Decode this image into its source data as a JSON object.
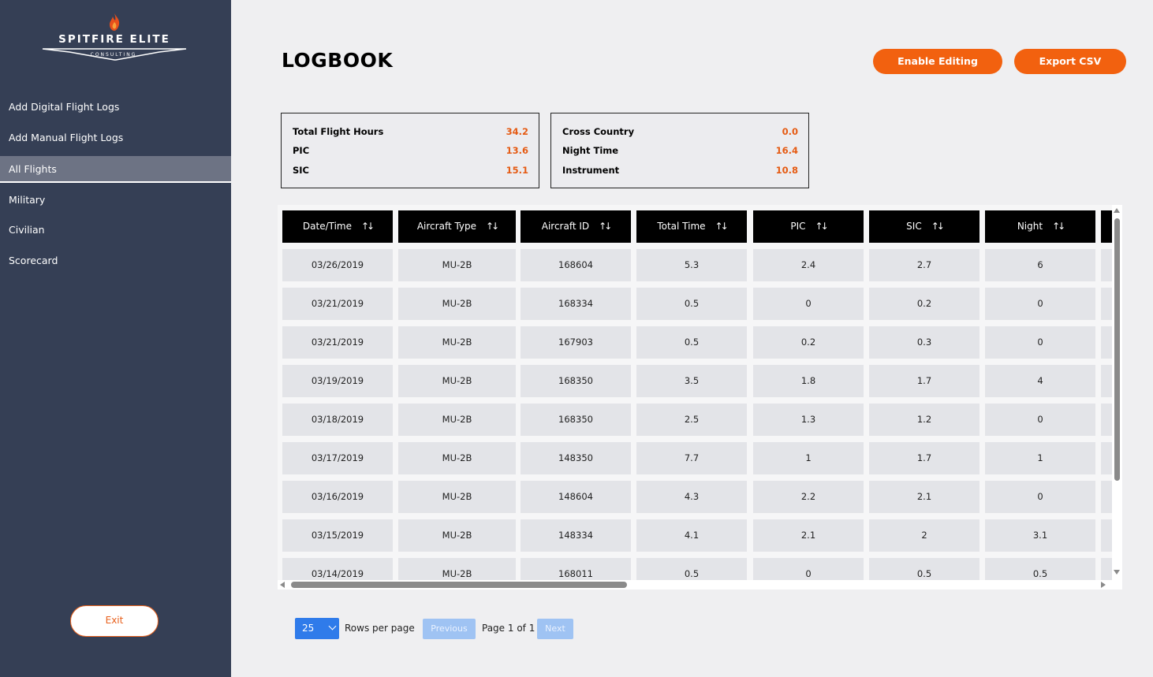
{
  "brand": {
    "name": "SPITFIRE ELITE",
    "subtitle": "CONSULTING"
  },
  "sidebar": {
    "items": [
      {
        "label": "Add Digital Flight Logs",
        "active": false
      },
      {
        "label": "Add Manual Flight Logs",
        "active": false
      },
      {
        "label": "All Flights",
        "active": true
      },
      {
        "label": "Military",
        "active": false
      },
      {
        "label": "Civilian",
        "active": false
      },
      {
        "label": "Scorecard",
        "active": false
      }
    ],
    "exit_label": "Exit"
  },
  "header": {
    "title": "LOGBOOK",
    "enable_editing_label": "Enable Editing",
    "export_label": "Export CSV"
  },
  "stats_left": [
    {
      "label": "Total Flight Hours",
      "value": "34.2"
    },
    {
      "label": "PIC",
      "value": "13.6"
    },
    {
      "label": "SIC",
      "value": "15.1"
    }
  ],
  "stats_right": [
    {
      "label": "Cross Country",
      "value": "0.0"
    },
    {
      "label": "Night Time",
      "value": "16.4"
    },
    {
      "label": "Instrument",
      "value": "10.8"
    }
  ],
  "table": {
    "columns": [
      "Date/Time",
      "Aircraft Type",
      "Aircraft ID",
      "Total Time",
      "PIC",
      "SIC",
      "Night"
    ],
    "sort_icon": "sort-updown-icon",
    "rows": [
      [
        "03/26/2019",
        "MU-2B",
        "168604",
        "5.3",
        "2.4",
        "2.7",
        "6"
      ],
      [
        "03/21/2019",
        "MU-2B",
        "168334",
        "0.5",
        "0",
        "0.2",
        "0"
      ],
      [
        "03/21/2019",
        "MU-2B",
        "167903",
        "0.5",
        "0.2",
        "0.3",
        "0"
      ],
      [
        "03/19/2019",
        "MU-2B",
        "168350",
        "3.5",
        "1.8",
        "1.7",
        "4"
      ],
      [
        "03/18/2019",
        "MU-2B",
        "168350",
        "2.5",
        "1.3",
        "1.2",
        "0"
      ],
      [
        "03/17/2019",
        "MU-2B",
        "148350",
        "7.7",
        "1",
        "1.7",
        "1"
      ],
      [
        "03/16/2019",
        "MU-2B",
        "148604",
        "4.3",
        "2.2",
        "2.1",
        "0"
      ],
      [
        "03/15/2019",
        "MU-2B",
        "148334",
        "4.1",
        "2.1",
        "2",
        "3.1"
      ],
      [
        "03/14/2019",
        "MU-2B",
        "168011",
        "0.5",
        "0",
        "0.5",
        "0.5"
      ]
    ]
  },
  "pagination": {
    "rows_per_page_value": "25",
    "rows_per_page_label": "Rows per page",
    "previous_label": "Previous",
    "page_info": "Page 1 of 1",
    "next_label": "Next"
  },
  "colors": {
    "sidebar_bg": "#353f55",
    "accent": "#f2610f",
    "value_orange": "#e55a12",
    "pager_blue": "#2f7bea"
  }
}
